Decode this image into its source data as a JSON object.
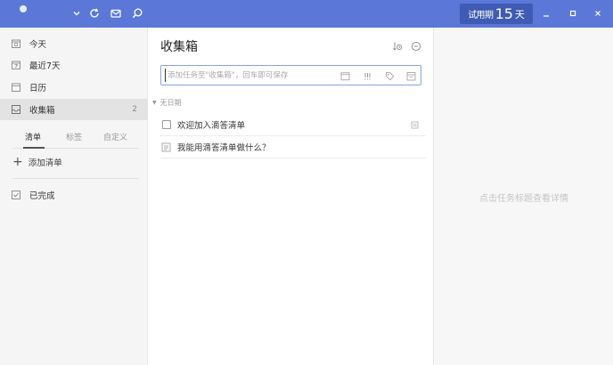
{
  "titlebar": {
    "trial_prefix": "试用期",
    "trial_days": "15",
    "trial_suffix": "天"
  },
  "sidebar": {
    "items": [
      {
        "label": "今天",
        "icon": "calendar-today-icon"
      },
      {
        "label": "最近7天",
        "icon": "calendar-week-icon"
      },
      {
        "label": "日历",
        "icon": "calendar-icon"
      },
      {
        "label": "收集箱",
        "icon": "inbox-icon",
        "count": "2",
        "active": true
      }
    ],
    "tabs": [
      {
        "label": "清单",
        "active": true
      },
      {
        "label": "标签"
      },
      {
        "label": "自定义"
      }
    ],
    "add_list_label": "添加清单",
    "completed_label": "已完成"
  },
  "main": {
    "title": "收集箱",
    "quick_add_placeholder": "添加任务至\"收集箱\"，回车即可保存",
    "section_label": "无日期",
    "tasks": [
      {
        "label": "欢迎加入滴答清单",
        "type": "checkbox"
      },
      {
        "label": "我能用滴答清单做什么？",
        "type": "note"
      }
    ]
  },
  "detail": {
    "hint": "点击任务标题查看详情"
  },
  "colors": {
    "titlebar": "#5b78d8",
    "trial_badge": "#3f5bb3",
    "accent_border": "#8aa3e6"
  }
}
